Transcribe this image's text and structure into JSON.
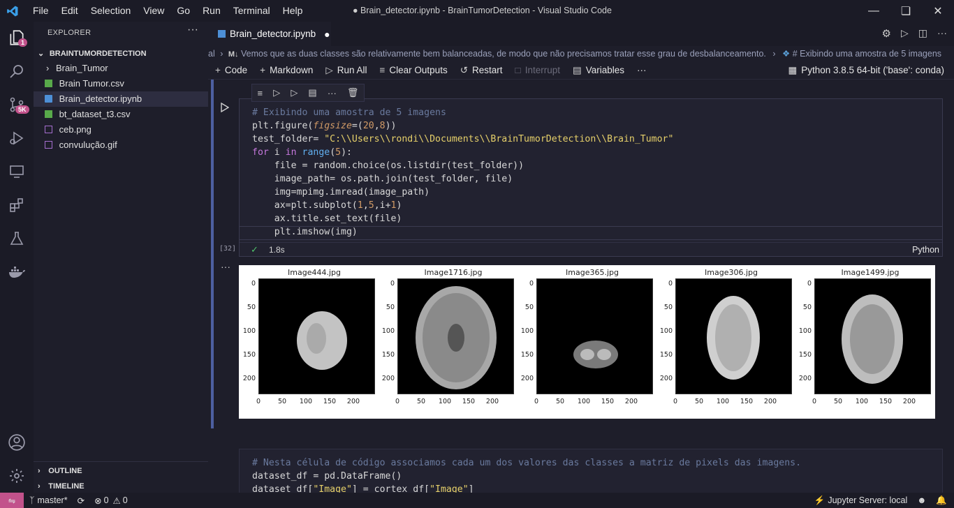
{
  "window": {
    "title": "● Brain_detector.ipynb - BrainTumorDetection - Visual Studio Code",
    "menu": [
      "File",
      "Edit",
      "Selection",
      "View",
      "Go",
      "Run",
      "Terminal",
      "Help"
    ]
  },
  "activity_bar": {
    "explorer_badge": "1",
    "source_control_badge": "5K"
  },
  "sidebar": {
    "title": "EXPLORER",
    "folder": "BRAINTUMORDETECTION",
    "items": [
      {
        "label": "Brain_Tumor",
        "type": "folder"
      },
      {
        "label": "Brain Tumor.csv",
        "type": "csv"
      },
      {
        "label": "Brain_detector.ipynb",
        "type": "notebook",
        "selected": true
      },
      {
        "label": "bt_dataset_t3.csv",
        "type": "csv"
      },
      {
        "label": "ceb.png",
        "type": "image"
      },
      {
        "label": "convulução.gif",
        "type": "image"
      }
    ],
    "outline": "OUTLINE",
    "timeline": "TIMELINE"
  },
  "tab": {
    "label": "Brain_detector.ipynb"
  },
  "breadcrumb": {
    "prefix": "al",
    "md_label": "M↓",
    "crumb1": "Vemos que as duas classes são relativamente bem balanceadas, de modo que não precisamos tratar esse grau de desbalanceamento.",
    "crumb2": "# Exibindo uma amostra de 5 imagens"
  },
  "toolbar": {
    "code": "Code",
    "markdown": "Markdown",
    "run_all": "Run All",
    "clear_outputs": "Clear Outputs",
    "restart": "Restart",
    "interrupt": "Interrupt",
    "variables": "Variables",
    "more": "···",
    "kernel": "Python 3.8.5 64-bit ('base': conda)"
  },
  "cell": {
    "exec_count": "[32]",
    "duration": "1.8s",
    "language": "Python",
    "output_menu": "···"
  },
  "plots": [
    {
      "title": "Image444.jpg"
    },
    {
      "title": "Image1716.jpg"
    },
    {
      "title": "Image365.jpg"
    },
    {
      "title": "Image306.jpg"
    },
    {
      "title": "Image1499.jpg"
    }
  ],
  "axis": {
    "y_ticks": [
      "0",
      "50",
      "100",
      "150",
      "200"
    ],
    "x_ticks": [
      "0",
      "50",
      "100",
      "150",
      "200"
    ]
  },
  "statusbar": {
    "branch": "master*",
    "errors": "0",
    "warnings": "0",
    "jupyter": "Jupyter Server: local"
  },
  "colors": {
    "accent": "#c2528b",
    "cell_border": "#4d5fa0"
  }
}
